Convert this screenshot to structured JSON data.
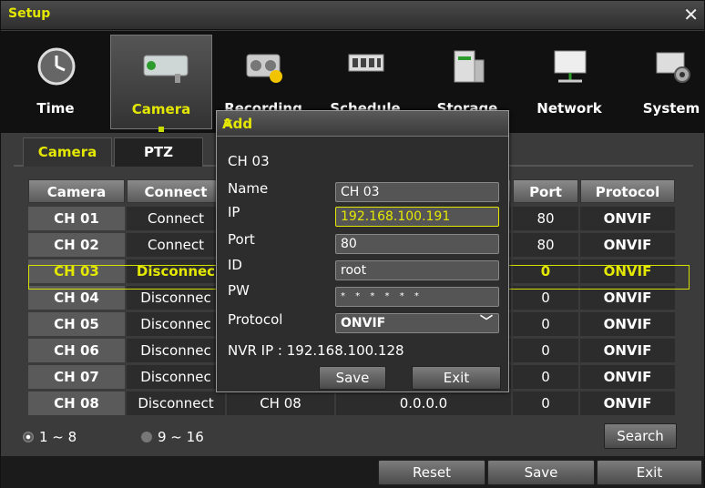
{
  "window": {
    "title": "Setup",
    "close": "✕"
  },
  "menu": [
    {
      "label": "Time",
      "icon": "clock-icon"
    },
    {
      "label": "Camera",
      "icon": "camera-icon"
    },
    {
      "label": "Recording",
      "icon": "recording-icon"
    },
    {
      "label": "Schedule",
      "icon": "schedule-icon"
    },
    {
      "label": "Storage",
      "icon": "storage-icon"
    },
    {
      "label": "Network",
      "icon": "network-icon"
    },
    {
      "label": "System",
      "icon": "system-icon"
    }
  ],
  "subtabs": [
    "Camera",
    "PTZ"
  ],
  "table": {
    "headers": [
      "Camera",
      "Connect",
      "",
      "",
      "Port",
      "Protocol"
    ],
    "rows": [
      {
        "camera": "CH 01",
        "connect": "Connect",
        "name": "",
        "ip": "",
        "port": "80",
        "protocol": "ONVIF"
      },
      {
        "camera": "CH 02",
        "connect": "Connect",
        "name": "",
        "ip": "",
        "port": "80",
        "protocol": "ONVIF"
      },
      {
        "camera": "CH 03",
        "connect": "Disconnec",
        "name": "",
        "ip": "",
        "port": "0",
        "protocol": "ONVIF"
      },
      {
        "camera": "CH 04",
        "connect": "Disconnec",
        "name": "",
        "ip": "",
        "port": "0",
        "protocol": "ONVIF"
      },
      {
        "camera": "CH 05",
        "connect": "Disconnec",
        "name": "",
        "ip": "",
        "port": "0",
        "protocol": "ONVIF"
      },
      {
        "camera": "CH 06",
        "connect": "Disconnec",
        "name": "",
        "ip": "",
        "port": "0",
        "protocol": "ONVIF"
      },
      {
        "camera": "CH 07",
        "connect": "Disconnec",
        "name": "",
        "ip": "",
        "port": "0",
        "protocol": "ONVIF"
      },
      {
        "camera": "CH 08",
        "connect": "Disconnect",
        "name": "CH 08",
        "ip": "0.0.0.0",
        "port": "0",
        "protocol": "ONVIF"
      }
    ]
  },
  "pages": {
    "first": "1 ~ 8",
    "second": "9 ~ 16"
  },
  "buttons": {
    "search": "Search",
    "reset": "Reset",
    "save": "Save",
    "exit": "Exit"
  },
  "dialog": {
    "title": "Add",
    "close": "✕",
    "channel": "CH 03",
    "name_label": "Name",
    "name_value": "CH 03",
    "ip_label": "IP",
    "ip_value": "192.168.100.191",
    "port_label": "Port",
    "port_value": "80",
    "id_label": "ID",
    "id_value": "root",
    "pw_label": "PW",
    "pw_value": "* * * * * *",
    "protocol_label": "Protocol",
    "protocol_value": "ONVIF",
    "nvr_ip": "NVR IP : 192.168.100.128",
    "save": "Save",
    "exit": "Exit"
  },
  "colors": {
    "accent": "#e4e800",
    "selection_border": "#d4e000"
  }
}
